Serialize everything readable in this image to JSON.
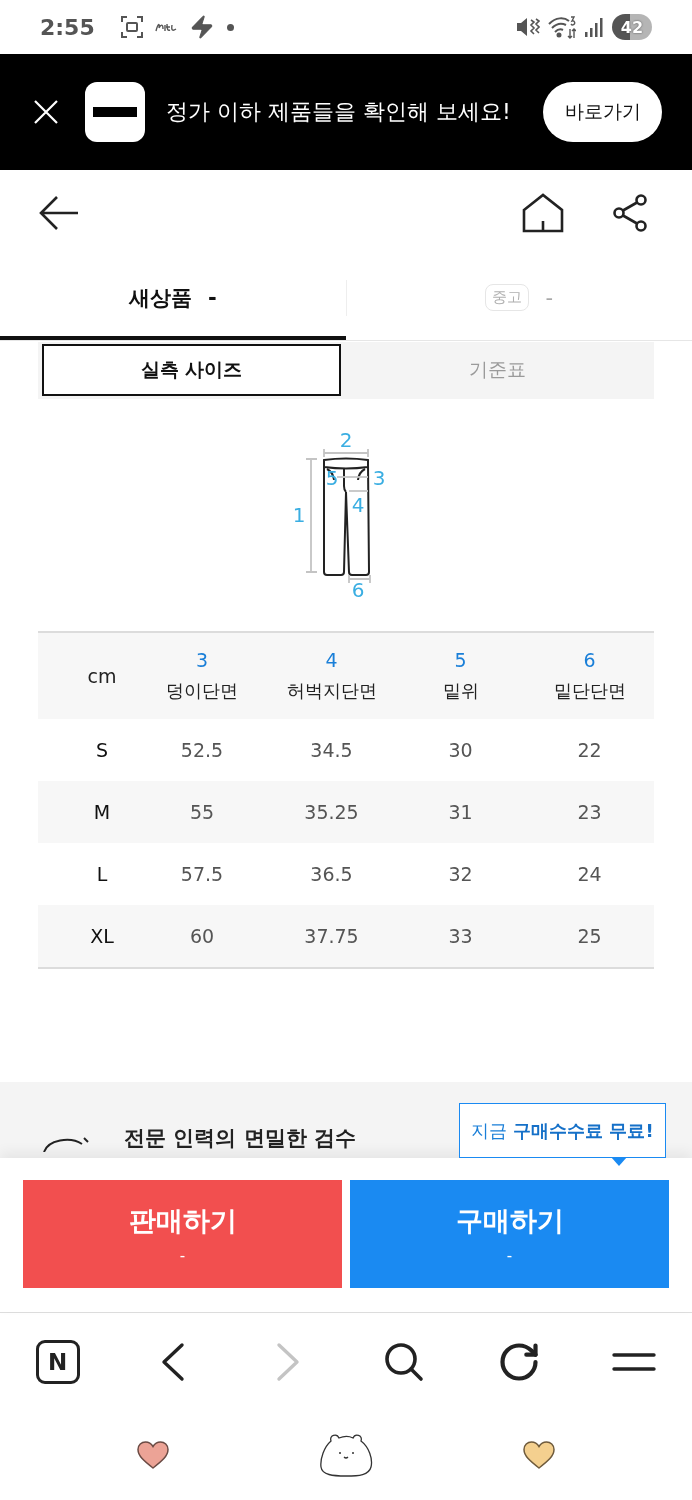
{
  "status_bar": {
    "time": "2:55",
    "battery": "42"
  },
  "banner": {
    "message": "정가 이하 제품들을 확인해 보세요!",
    "button": "바로가기"
  },
  "condition_tabs": [
    {
      "label": "새상품",
      "price": "-",
      "kind": "plain",
      "selected": true
    },
    {
      "label": "중고",
      "price": "-",
      "kind": "badge",
      "selected": false
    }
  ],
  "size_tabs": [
    {
      "label": "실측 사이즈",
      "selected": true
    },
    {
      "label": "기준표",
      "selected": false
    }
  ],
  "diagram": {
    "labels": [
      "1",
      "2",
      "3",
      "4",
      "5",
      "6"
    ]
  },
  "size_table": {
    "unit": "cm",
    "columns": [
      {
        "number": "3",
        "label": "덩이단면"
      },
      {
        "number": "4",
        "label": "허벅지단면"
      },
      {
        "number": "5",
        "label": "밑위"
      },
      {
        "number": "6",
        "label": "밑단단면"
      }
    ],
    "rows": [
      {
        "size": "S",
        "values": [
          "52.5",
          "34.5",
          "30",
          "22"
        ]
      },
      {
        "size": "M",
        "values": [
          "55",
          "35.25",
          "31",
          "23"
        ]
      },
      {
        "size": "L",
        "values": [
          "57.5",
          "36.5",
          "32",
          "24"
        ]
      },
      {
        "size": "XL",
        "values": [
          "60",
          "37.75",
          "33",
          "25"
        ]
      }
    ]
  },
  "inspection_section": {
    "title": "전문 인력의 면밀한 검수"
  },
  "tooltip": {
    "text": "지금 **구매수수료 무료!**"
  },
  "actions": [
    {
      "kind": "sell",
      "label": "판매하기",
      "price": "-"
    },
    {
      "kind": "buy",
      "label": "구매하기",
      "price": "-"
    }
  ],
  "browser_toolbar": {
    "home_label": "N",
    "forward_disabled": true
  }
}
